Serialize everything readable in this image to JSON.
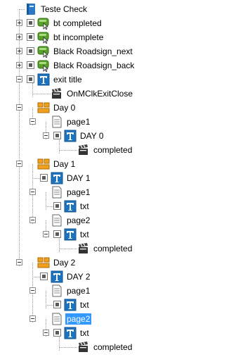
{
  "tree": {
    "nodes": [
      {
        "label": "Teste Check",
        "icon": "book-icon",
        "expander": "none",
        "checkbox": false
      },
      {
        "label": "bt completed",
        "icon": "button-object-icon",
        "expander": "plus",
        "checkbox": true
      },
      {
        "label": "bt incomplete",
        "icon": "button-object-icon",
        "expander": "plus",
        "checkbox": true
      },
      {
        "label": "Black Roadsign_next",
        "icon": "button-object-icon",
        "expander": "plus",
        "checkbox": true
      },
      {
        "label": "Black Roadsign_back",
        "icon": "button-object-icon",
        "expander": "plus",
        "checkbox": true
      },
      {
        "label": "exit title",
        "icon": "text-object-icon",
        "expander": "minus",
        "checkbox": true
      },
      {
        "label": "OnMClkExitClose",
        "icon": "clapperboard-icon",
        "expander": "none",
        "checkbox": false
      },
      {
        "label": "Day 0",
        "icon": "chapter-icon",
        "expander": "minus",
        "checkbox": false
      },
      {
        "label": "page1",
        "icon": "page-icon",
        "expander": "minus",
        "checkbox": false
      },
      {
        "label": "DAY 0",
        "icon": "text-object-icon",
        "expander": "minus",
        "checkbox": true
      },
      {
        "label": "completed",
        "icon": "clapperboard-icon",
        "expander": "none",
        "checkbox": false
      },
      {
        "label": "Day 1",
        "icon": "chapter-icon",
        "expander": "minus",
        "checkbox": false
      },
      {
        "label": "DAY 1",
        "icon": "text-object-icon",
        "expander": "none",
        "checkbox": true
      },
      {
        "label": "page1",
        "icon": "page-icon",
        "expander": "minus",
        "checkbox": false
      },
      {
        "label": "txt",
        "icon": "text-object-icon",
        "expander": "none",
        "checkbox": true
      },
      {
        "label": "page2",
        "icon": "page-icon",
        "expander": "minus",
        "checkbox": false
      },
      {
        "label": "txt",
        "icon": "text-object-icon",
        "expander": "minus",
        "checkbox": true
      },
      {
        "label": "completed",
        "icon": "clapperboard-icon",
        "expander": "none",
        "checkbox": false
      },
      {
        "label": "Day 2",
        "icon": "chapter-icon",
        "expander": "minus",
        "checkbox": false
      },
      {
        "label": "DAY 2",
        "icon": "text-object-icon",
        "expander": "none",
        "checkbox": true
      },
      {
        "label": "page1",
        "icon": "page-icon",
        "expander": "minus",
        "checkbox": false
      },
      {
        "label": "txt",
        "icon": "text-object-icon",
        "expander": "none",
        "checkbox": true
      },
      {
        "label": "page2",
        "icon": "page-icon",
        "expander": "minus",
        "checkbox": false,
        "selected": true
      },
      {
        "label": "txt",
        "icon": "text-object-icon",
        "expander": "minus",
        "checkbox": true
      },
      {
        "label": "completed",
        "icon": "clapperboard-icon",
        "expander": "none",
        "checkbox": false
      }
    ]
  },
  "colors": {
    "selection": "#3399ff",
    "text_icon": "#1e73be",
    "button_icon": "#5aa02c",
    "chapter_icon": "#f0a020",
    "book_icon": "#2b78c5"
  }
}
